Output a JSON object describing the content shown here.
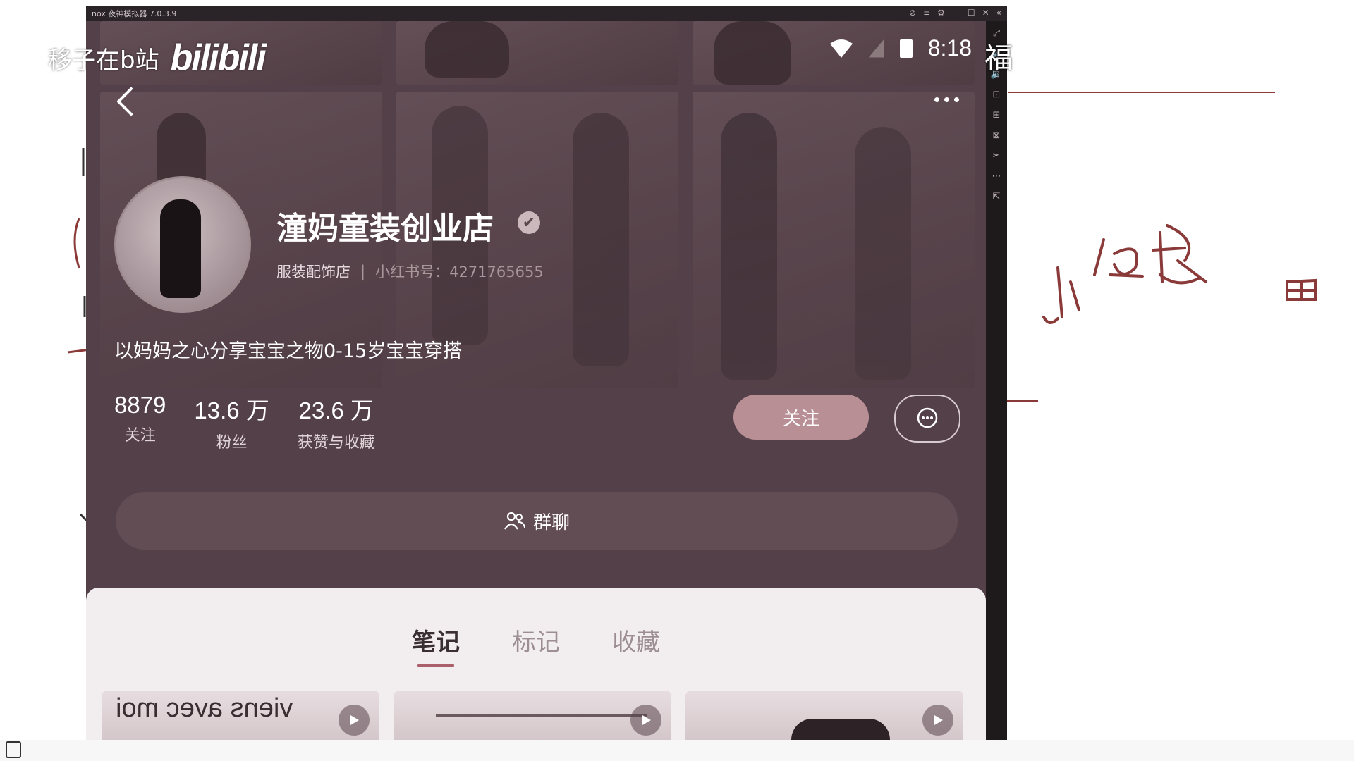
{
  "emulator": {
    "title": "nox 夜神模拟器 7.0.3.9",
    "controls": [
      "⊘",
      "≡",
      "⚙",
      "—",
      "☐",
      "✕",
      "«"
    ],
    "side_tools": [
      "⤢",
      "🔈",
      "🔉",
      "⊡",
      "⊞",
      "⊠",
      "✂",
      "⋯",
      "⇱"
    ]
  },
  "watermark": {
    "uploader": "移子在b站",
    "logo": "bilibili",
    "edge_char": "福"
  },
  "status_bar": {
    "time": "8:18"
  },
  "profile": {
    "name": "潼妈童装创业店",
    "category": "服装配饰店",
    "separator": "|",
    "red_id": "小红书号：4271765655",
    "bio": "以妈妈之心分享宝宝之物0-15岁宝宝穿搭",
    "stats": [
      {
        "num": "8879",
        "label": "关注"
      },
      {
        "num": "13.6 万",
        "label": "粉丝"
      },
      {
        "num": "23.6 万",
        "label": "获赞与收藏"
      }
    ],
    "follow_label": "关注",
    "group_chat_label": "群聊"
  },
  "tabs": [
    {
      "label": "笔记",
      "active": true
    },
    {
      "label": "标记",
      "active": false
    },
    {
      "label": "收藏",
      "active": false
    }
  ],
  "thumbnails": [
    {
      "text": "viens avec moi",
      "type": "video"
    },
    {
      "text": "",
      "type": "video"
    },
    {
      "text": "",
      "type": "video"
    }
  ],
  "colors": {
    "accent": "#a9606a",
    "follow": "#b98f96",
    "bg": "#544048",
    "pen": "#8b3a3a"
  }
}
